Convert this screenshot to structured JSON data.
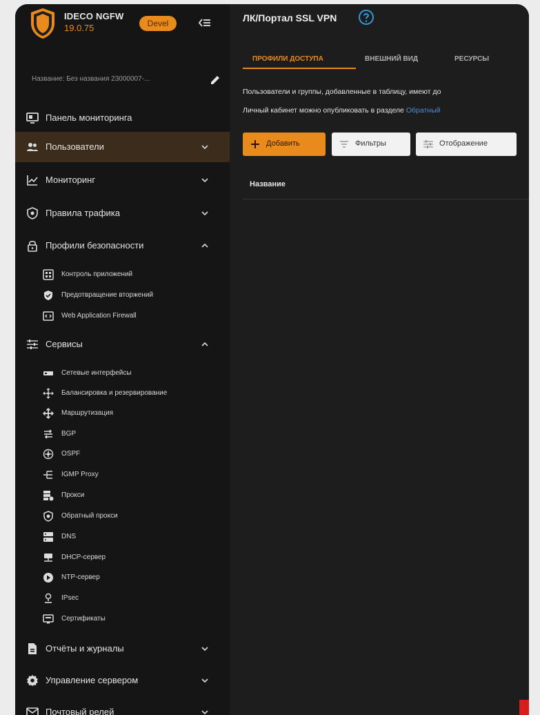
{
  "brand": {
    "name": "IDECO NGFW",
    "version": "19.0.75",
    "badge": "Devel",
    "logo_icon": "shield-logo-icon",
    "accent_color": "#e98b1c"
  },
  "server_name": "Название: Без названия 23000007-...",
  "sidebar": {
    "items": [
      {
        "label": "Панель мониторинга",
        "icon": "monitor-icon"
      },
      {
        "label": "Пользователи",
        "icon": "users-icon",
        "active": true
      },
      {
        "label": "Мониторинг",
        "icon": "chart-line-icon"
      },
      {
        "label": "Правила трафика",
        "icon": "shield-icon"
      },
      {
        "label": "Профили безопасности",
        "icon": "lock-icon",
        "expanded": true
      },
      {
        "label": "Сервисы",
        "icon": "sliders-icon",
        "expanded": true
      },
      {
        "label": "Отчёты и журналы",
        "icon": "report-icon"
      },
      {
        "label": "Управление сервером",
        "icon": "gear-icon"
      },
      {
        "label": "Почтовый релей",
        "icon": "mail-icon"
      }
    ],
    "security_sub": [
      {
        "label": "Контроль приложений",
        "icon": "app-control-icon"
      },
      {
        "label": "Предотвращение вторжений",
        "icon": "shield-check-icon"
      },
      {
        "label": "Web Application Firewall",
        "icon": "waf-icon"
      }
    ],
    "services_sub": [
      {
        "label": "Сетевые интерфейсы",
        "icon": "network-card-icon"
      },
      {
        "label": "Балансировка и резервирование",
        "icon": "balance-icon"
      },
      {
        "label": "Маршрутизация",
        "icon": "routing-icon"
      },
      {
        "label": "BGP",
        "icon": "bgp-icon"
      },
      {
        "label": "OSPF",
        "icon": "ospf-icon"
      },
      {
        "label": "IGMP Proxy",
        "icon": "igmp-icon"
      },
      {
        "label": "Прокси",
        "icon": "proxy-icon"
      },
      {
        "label": "Обратный прокси",
        "icon": "reverse-proxy-icon"
      },
      {
        "label": "DNS",
        "icon": "dns-icon"
      },
      {
        "label": "DHCP-сервер",
        "icon": "dhcp-icon"
      },
      {
        "label": "NTP-сервер",
        "icon": "clock-icon"
      },
      {
        "label": "IPsec",
        "icon": "ipsec-icon"
      },
      {
        "label": "Сертификаты",
        "icon": "certificate-icon"
      }
    ]
  },
  "main": {
    "title": "ЛК/Портал SSL VPN",
    "tabs": [
      {
        "label": "ПРОФИЛИ ДОСТУПА",
        "active": true
      },
      {
        "label": "ВНЕШНИЙ ВИД"
      },
      {
        "label": "РЕСУРСЫ"
      }
    ],
    "description_line1": "Пользователи и группы, добавленные в таблицу, имеют до",
    "description_line2_prefix": "Личный кабинет можно опубликовать в разделе ",
    "description_line2_link": "Обратный",
    "buttons": {
      "add": "Добавить",
      "filters": "Фильтры",
      "display": "Отображение"
    },
    "table_columns": [
      "Название"
    ]
  },
  "colors": {
    "sidebar_bg": "#151515",
    "main_bg": "#1d1d1d",
    "active_item_bg": "#3b2c1c",
    "link": "#4f8fd6",
    "corner_mark": "#d61e1e"
  }
}
